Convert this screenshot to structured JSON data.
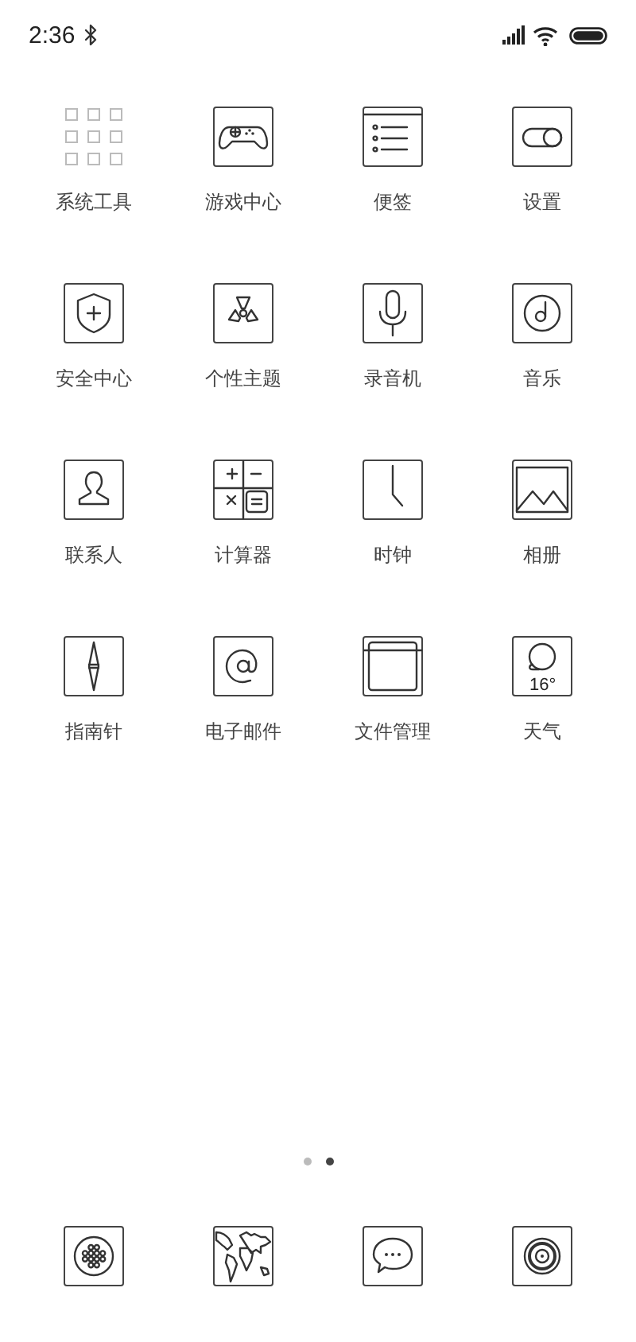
{
  "status_bar": {
    "time": "2:36"
  },
  "app_rows": [
    {
      "apps": [
        {
          "kind": "folder",
          "label": "系统工具"
        },
        {
          "kind": "gamepad",
          "label": "游戏中心"
        },
        {
          "kind": "notes",
          "label": "便签"
        },
        {
          "kind": "toggle",
          "label": "设置"
        }
      ]
    },
    {
      "apps": [
        {
          "kind": "shield",
          "label": "安全中心"
        },
        {
          "kind": "theme",
          "label": "个性主题"
        },
        {
          "kind": "mic",
          "label": "录音机"
        },
        {
          "kind": "music",
          "label": "音乐"
        }
      ]
    },
    {
      "apps": [
        {
          "kind": "person",
          "label": "联系人"
        },
        {
          "kind": "calculator",
          "label": "计算器"
        },
        {
          "kind": "clock",
          "label": "时钟"
        },
        {
          "kind": "gallery",
          "label": "相册"
        }
      ]
    },
    {
      "apps": [
        {
          "kind": "compass",
          "label": "指南针"
        },
        {
          "kind": "email",
          "label": "电子邮件"
        },
        {
          "kind": "files",
          "label": "文件管理"
        },
        {
          "kind": "weather",
          "icon_text": "16°",
          "label": "天气"
        }
      ]
    }
  ],
  "page_dots": [
    {
      "selected": false
    },
    {
      "selected": true
    }
  ],
  "dock": [
    {
      "kind": "dialpad"
    },
    {
      "kind": "map"
    },
    {
      "kind": "chat"
    },
    {
      "kind": "camera"
    }
  ]
}
